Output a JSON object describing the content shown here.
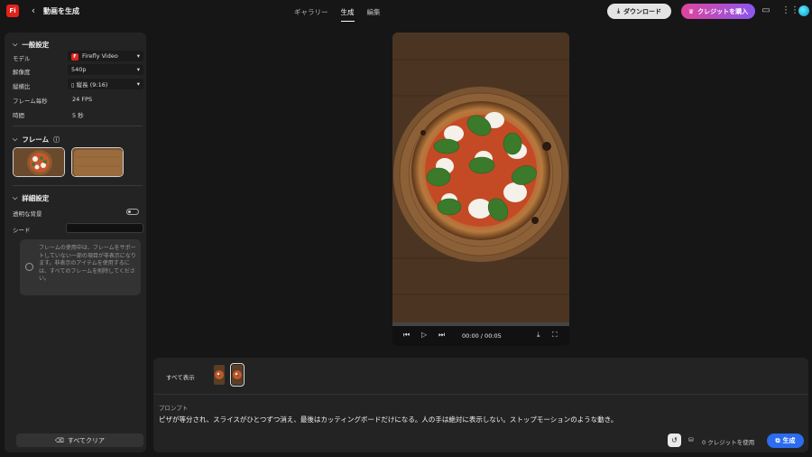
{
  "app": {
    "logo": "Fi",
    "title": "動画を生成"
  },
  "tabs": [
    {
      "label": "ギャラリー"
    },
    {
      "label": "生成",
      "active": true
    },
    {
      "label": "編集"
    }
  ],
  "topbar": {
    "download_label": "ダウンロード",
    "buy_credits_label": "クレジットを購入",
    "accent_color": "#2b6cf0"
  },
  "sidebar": {
    "general": {
      "title": "一般設定",
      "model": {
        "label": "モデル",
        "value": "Firefly Video"
      },
      "resolution": {
        "label": "解像度",
        "value": "540p"
      },
      "aspect": {
        "label": "縦横比",
        "value": "縦長 (9:16)"
      },
      "fps": {
        "label": "フレーム毎秒",
        "value": "24 FPS"
      },
      "duration": {
        "label": "時間",
        "value": "5 秒"
      }
    },
    "frames": {
      "title": "フレーム"
    },
    "advanced": {
      "title": "詳細設定",
      "transparent_bg": {
        "label": "透明な背景",
        "enabled": false
      },
      "seed": {
        "label": "シード",
        "value": ""
      },
      "notice": "フレームの使用中は、フレームをサポートしていない一部の項目が非表示になります。非表示のアイテムを使用するには、すべてのフレームを削除してください。"
    },
    "clear_all_label": "すべてクリア"
  },
  "player": {
    "timecode": "00:00 / 00:05",
    "progress": 0
  },
  "bottom": {
    "show_all_label": "すべて表示",
    "prompt_label": "プロンプト",
    "prompt_text": "ピザが等分され、スライスがひとつずつ消え、最後はカッティングボードだけになる。人の手は絶対に表示しない。ストップモーションのような動き。",
    "credit_use_label": "0 クレジットを使用",
    "generate_label": "生成"
  }
}
